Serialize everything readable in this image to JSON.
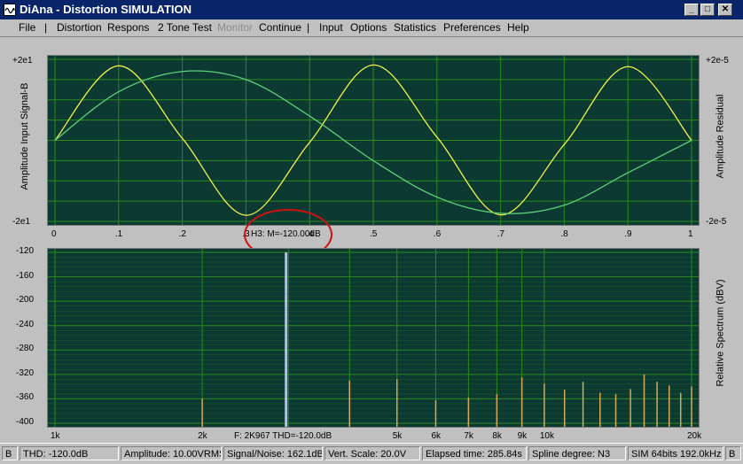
{
  "window": {
    "title": "DiAna - Distortion SIMULATION",
    "controls": {
      "minimize": "_",
      "maximize": "□",
      "close": "✕"
    }
  },
  "menu": {
    "items": [
      "File",
      "Distortion",
      "Respons",
      "2 Tone Test",
      "Monitor",
      "Continue",
      "Input",
      "Options",
      "Statistics",
      "Preferences",
      "Help"
    ],
    "separators": [
      "|",
      "|"
    ]
  },
  "top_plot": {
    "left_label": "Amplitude Input Signal-B",
    "right_label": "Amplitude Residual",
    "left_top": "+2e1",
    "left_bottom": "-2e1",
    "right_top": "+2e-5",
    "right_bottom": "-2e-5",
    "x_ticks": [
      "0",
      ".1",
      ".2",
      ".3",
      ".4",
      ".5",
      ".6",
      ".7",
      ".8",
      ".9",
      "1"
    ],
    "annotation": "H3: M=-120.00dB",
    "colors": {
      "background": "#0c3a32",
      "grid": "#2a8a1a",
      "signal": "#f2f24a",
      "residual": "#5fd07a",
      "highlight": "#d01010"
    }
  },
  "bottom_plot": {
    "right_label": "Relative Spectrum (dBV)",
    "y_ticks": [
      "-120",
      "-160",
      "-200",
      "-240",
      "-280",
      "-320",
      "-360",
      "-400"
    ],
    "x_ticks": [
      "1k",
      "2k",
      "5k",
      "6k",
      "7k",
      "8k",
      "9k",
      "10k",
      "20k"
    ],
    "readout": "F: 2K967 THD=-120.0dB",
    "colors": {
      "background": "#0c3a32",
      "grid": "#2a8a1a",
      "bars": "#d8a85a",
      "main_bar": "#b8b8f0"
    }
  },
  "statusbar": {
    "fields": [
      "B",
      "THD: -120.0dB",
      "Amplitude: 10.00VRMS",
      "Signal/Noise:  162.1dB",
      "Vert. Scale: 20.0V",
      "Elapsed time: 285.84s",
      "Spline degree: N3",
      "SIM 64bits 192.0kHz",
      "B"
    ]
  },
  "chart_data": [
    {
      "type": "line",
      "xlabel": "",
      "ylabel": "Amplitude Input Signal-B",
      "xlim": [
        0,
        1
      ],
      "ylim": [
        -20,
        20
      ],
      "series": [
        {
          "x": [
            0,
            0.1,
            0.2,
            0.3,
            0.4,
            0.5,
            0.6,
            0.7,
            0.8,
            0.9,
            1.0
          ],
          "values": [
            0,
            18.4,
            0.5,
            -18.5,
            -0.5,
            18.6,
            0.8,
            -18.4,
            -1.0,
            18.2,
            0
          ]
        },
        {
          "x": [
            0,
            0.1,
            0.2,
            0.3,
            0.4,
            0.5,
            0.6,
            0.7,
            0.8,
            0.9,
            1.0
          ],
          "values": [
            0,
            12,
            17,
            15,
            6,
            -5,
            -14,
            -18,
            -16,
            -8,
            0
          ]
        }
      ]
    },
    {
      "type": "bar",
      "xlabel": "",
      "ylabel": "Relative Spectrum (dBV)",
      "ylim": [
        -400,
        -120
      ],
      "categories": [
        "2k",
        "2.967k",
        "4k",
        "5k",
        "6k",
        "7k",
        "8k",
        "9k",
        "10k",
        "11k",
        "12k",
        "13k",
        "14k",
        "15k",
        "16k",
        "17k",
        "18k",
        "19k",
        "20k"
      ],
      "values": [
        -360,
        -120,
        -330,
        -328,
        -362,
        -358,
        -352,
        -325,
        -335,
        -345,
        -332,
        -350,
        -352,
        -344,
        -320,
        -332,
        -338,
        -350,
        -340
      ]
    }
  ]
}
